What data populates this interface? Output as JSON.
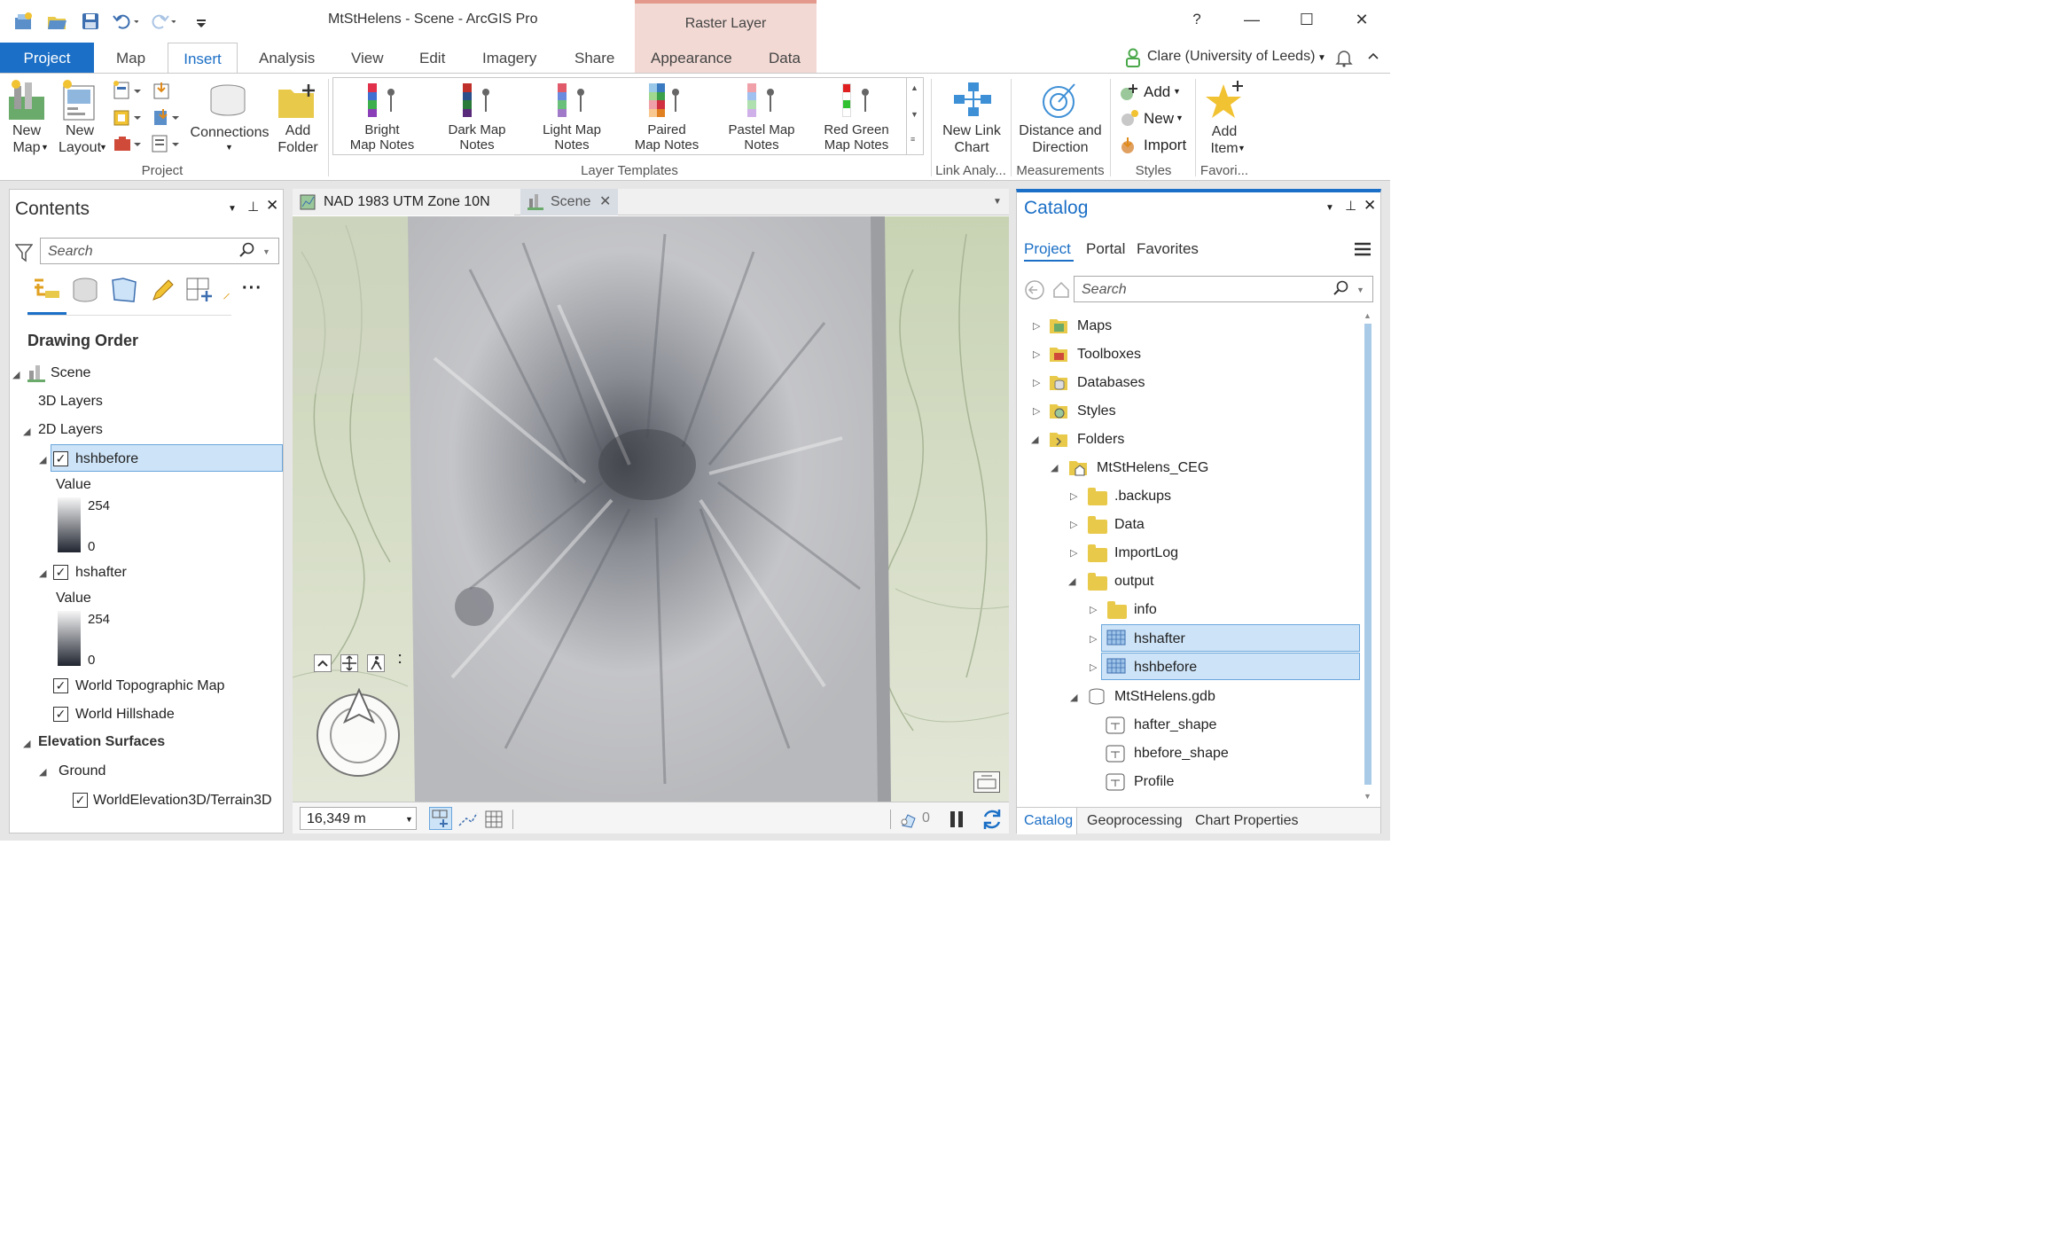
{
  "window": {
    "title": "MtStHelens - Scene - ArcGIS Pro",
    "contextual_group": "Raster Layer",
    "help": "?",
    "minimize": "—",
    "maximize": "☐",
    "close": "✕"
  },
  "tabs": {
    "project": "Project",
    "items": [
      "Map",
      "Insert",
      "Analysis",
      "View",
      "Edit",
      "Imagery",
      "Share",
      "Appearance",
      "Data"
    ],
    "active": "Insert"
  },
  "user": "Clare (University of Leeds)",
  "ribbon": {
    "project_group": "Project",
    "new_map": "New\nMap",
    "new_layout": "New\nLayout",
    "connections": "Connections",
    "add_folder": "Add\nFolder",
    "layer_templates_group": "Layer Templates",
    "templates": [
      {
        "label": "Bright\nMap Notes",
        "colors": [
          "#e0304a",
          "#3f6fd1",
          "#3cae4c",
          "#8a3fb8"
        ]
      },
      {
        "label": "Dark Map\nNotes",
        "colors": [
          "#c0302a",
          "#2a4f8a",
          "#2a7a3a",
          "#5a2a7a"
        ]
      },
      {
        "label": "Light Map\nNotes",
        "colors": [
          "#e05a6a",
          "#6a8ae0",
          "#6ac07a",
          "#a07ac8"
        ]
      },
      {
        "label": "Paired\nMap Notes",
        "colors": [
          "#9ac8e8",
          "#3a7ac0",
          "#a0d890",
          "#3aa04a"
        ]
      },
      {
        "label": "Pastel Map\nNotes",
        "colors": [
          "#f0a0a8",
          "#a0c0f0",
          "#b0e0b0",
          "#d0b0e8"
        ]
      },
      {
        "label": "Red Green\nMap Notes",
        "colors": [
          "#e02020",
          "#ffffff",
          "#30c030",
          "#ffffff"
        ]
      }
    ],
    "new_link_chart": "New Link\nChart",
    "link_group": "Link Analy...",
    "distance_direction": "Distance and\nDirection",
    "measurements_group": "Measurements",
    "styles_add": "Add",
    "styles_new": "New",
    "styles_import": "Import",
    "styles_group": "Styles",
    "add_item": "Add\nItem",
    "favorites_group": "Favori..."
  },
  "contents": {
    "title": "Contents",
    "search_placeholder": "Search",
    "heading": "Drawing Order",
    "scene": "Scene",
    "layers_3d": "3D Layers",
    "layers_2d": "2D Layers",
    "layer1": "hshbefore",
    "value_label": "Value",
    "high": "254",
    "low": "0",
    "layer2": "hshafter",
    "world_topo": "World Topographic Map",
    "world_hillshade": "World Hillshade",
    "elevation_surfaces": "Elevation Surfaces",
    "ground": "Ground",
    "terrain": "WorldElevation3D/Terrain3D"
  },
  "map": {
    "tab1": "NAD 1983 UTM Zone 10N",
    "tab2": "Scene",
    "scale": "16,349 m",
    "selected_count": "0"
  },
  "catalog": {
    "title": "Catalog",
    "subtabs": [
      "Project",
      "Portal",
      "Favorites"
    ],
    "search_placeholder": "Search",
    "items": {
      "maps": "Maps",
      "toolboxes": "Toolboxes",
      "databases": "Databases",
      "styles": "Styles",
      "folders": "Folders",
      "project_folder": "MtStHelens_CEG",
      "backups": ".backups",
      "data": "Data",
      "importlog": "ImportLog",
      "output": "output",
      "info": "info",
      "hshafter": "hshafter",
      "hshbefore": "hshbefore",
      "gdb": "MtStHelens.gdb",
      "hafter_shape": "hafter_shape",
      "hbefore_shape": "hbefore_shape",
      "profile": "Profile"
    },
    "bottom_tabs": [
      "Catalog",
      "Geoprocessing",
      "Chart Properties"
    ]
  }
}
